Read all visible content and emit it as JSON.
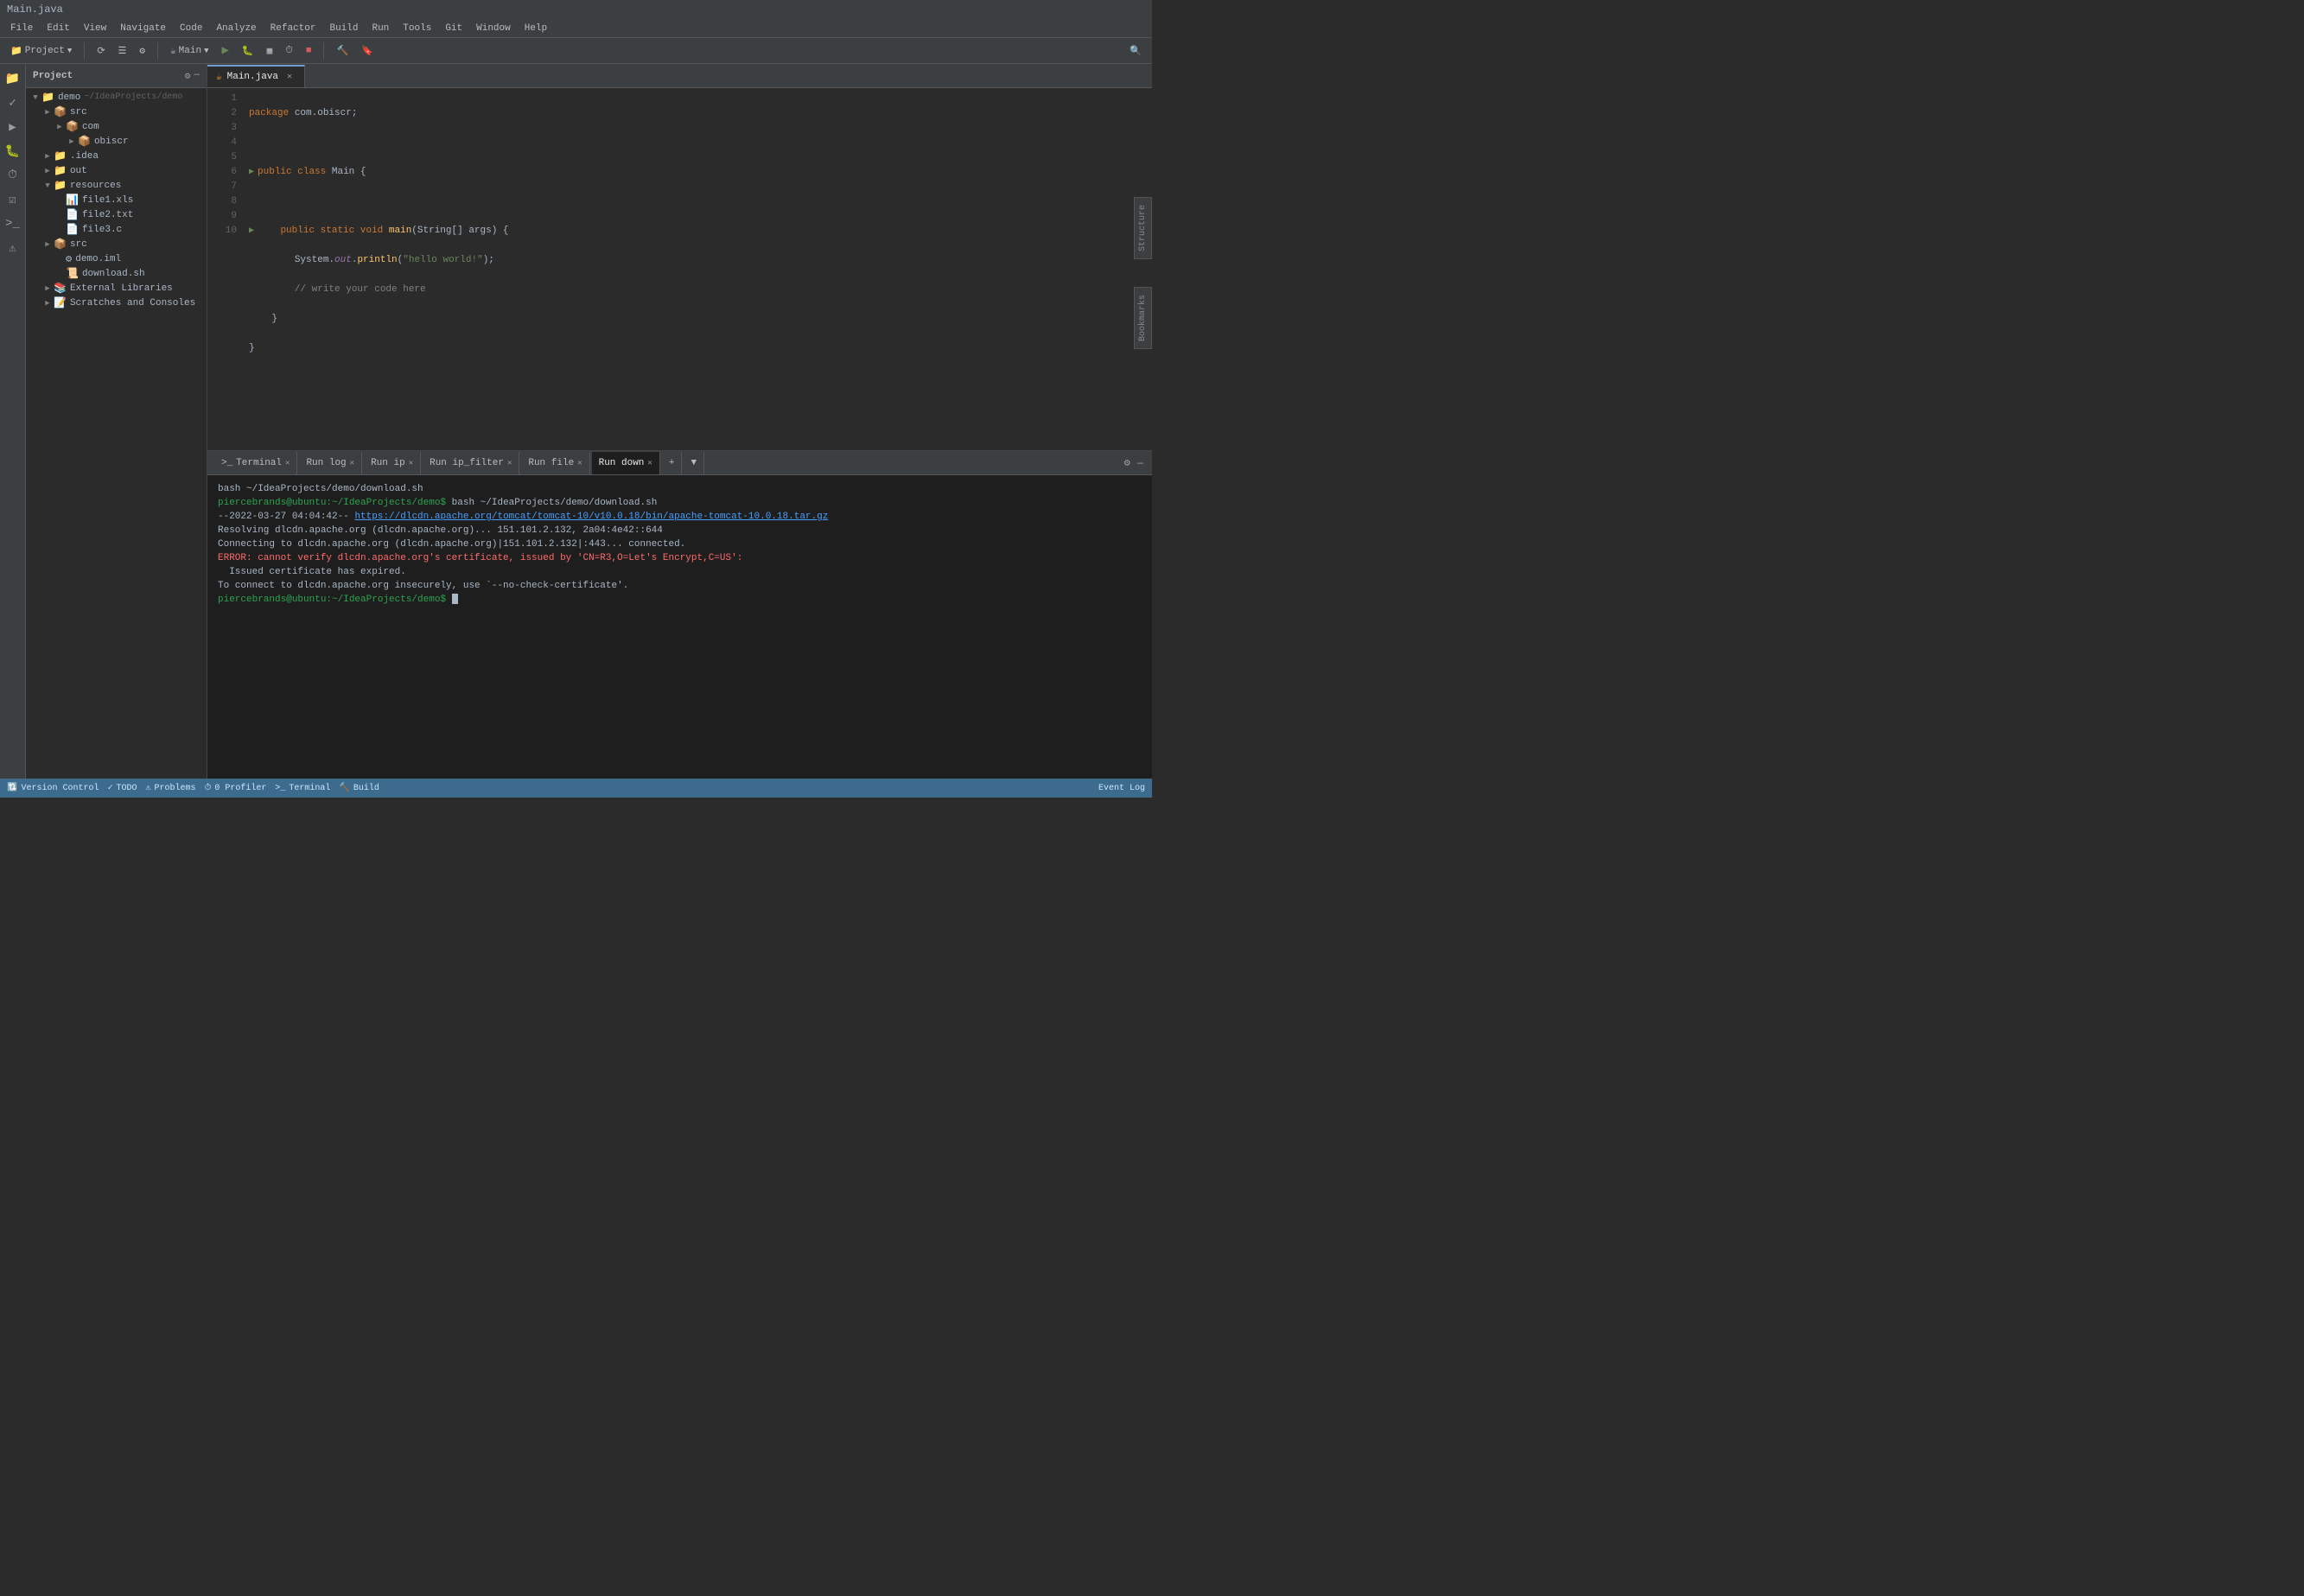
{
  "titleBar": {
    "title": "Main.java"
  },
  "menuBar": {
    "items": [
      "File",
      "Edit",
      "View",
      "Navigate",
      "Code",
      "Analyze",
      "Refactor",
      "Build",
      "Run",
      "Tools",
      "Git",
      "Window",
      "Help"
    ]
  },
  "toolbar": {
    "projectDropdown": "Project",
    "configDropdown": "Main",
    "runBtn": "▶",
    "debugBtn": "🐛",
    "coverageBtn": "▦",
    "profileBtn": "⏱",
    "buildBtn": "🔨",
    "searchBtn": "🔍"
  },
  "sidebar": {
    "title": "Project",
    "tree": [
      {
        "id": "demo",
        "label": "demo",
        "path": "~/IdeaProjects/demo",
        "depth": 0,
        "expanded": true,
        "icon": "📁",
        "type": "folder"
      },
      {
        "id": "src",
        "label": "src",
        "depth": 1,
        "expanded": false,
        "icon": "📁",
        "type": "folder"
      },
      {
        "id": "com",
        "label": "com",
        "depth": 2,
        "expanded": false,
        "icon": "📁",
        "type": "folder"
      },
      {
        "id": "obiscr",
        "label": "obiscr",
        "depth": 3,
        "expanded": false,
        "icon": "📁",
        "type": "folder"
      },
      {
        "id": "idea",
        "label": ".idea",
        "depth": 1,
        "expanded": false,
        "icon": "📁",
        "type": "folder"
      },
      {
        "id": "out",
        "label": "out",
        "depth": 1,
        "expanded": false,
        "icon": "📁",
        "type": "folder"
      },
      {
        "id": "resources",
        "label": "resources",
        "depth": 1,
        "expanded": true,
        "icon": "📁",
        "type": "folder"
      },
      {
        "id": "file1xls",
        "label": "file1.xls",
        "depth": 2,
        "icon": "📄",
        "type": "file"
      },
      {
        "id": "file2txt",
        "label": "file2.txt",
        "depth": 2,
        "icon": "📄",
        "type": "file"
      },
      {
        "id": "file3c",
        "label": "file3.c",
        "depth": 2,
        "icon": "📄",
        "type": "file"
      },
      {
        "id": "src2",
        "label": "src",
        "depth": 1,
        "expanded": false,
        "icon": "📁",
        "type": "folder"
      },
      {
        "id": "demoiml",
        "label": "demo.iml",
        "depth": 2,
        "icon": "📄",
        "type": "file"
      },
      {
        "id": "downloadsh",
        "label": "download.sh",
        "depth": 2,
        "icon": "📄",
        "type": "file"
      },
      {
        "id": "extlibs",
        "label": "External Libraries",
        "depth": 1,
        "icon": "📚",
        "type": "folder"
      },
      {
        "id": "scratches",
        "label": "Scratches and Consoles",
        "depth": 1,
        "icon": "📝",
        "type": "folder"
      }
    ]
  },
  "editor": {
    "tabs": [
      {
        "id": "main-java",
        "label": "Main.java",
        "active": true,
        "icon": "☕"
      }
    ],
    "code": [
      {
        "line": 1,
        "content": "package com.obiscr;",
        "hasArrow": false
      },
      {
        "line": 2,
        "content": "",
        "hasArrow": false
      },
      {
        "line": 3,
        "content": "public class Main {",
        "hasArrow": true
      },
      {
        "line": 4,
        "content": "",
        "hasArrow": false
      },
      {
        "line": 5,
        "content": "    public static void main(String[] args) {",
        "hasArrow": true
      },
      {
        "line": 6,
        "content": "        System.out.println(\"hello world!\");",
        "hasArrow": false
      },
      {
        "line": 7,
        "content": "        // write your code here",
        "hasArrow": false
      },
      {
        "line": 8,
        "content": "    }",
        "hasArrow": false
      },
      {
        "line": 9,
        "content": "}",
        "hasArrow": false
      },
      {
        "line": 10,
        "content": "",
        "hasArrow": false
      }
    ]
  },
  "terminal": {
    "tabs": [
      {
        "id": "terminal",
        "label": "Terminal",
        "active": false
      },
      {
        "id": "run-log",
        "label": "Run log",
        "active": false
      },
      {
        "id": "run-ip",
        "label": "Run ip",
        "active": false
      },
      {
        "id": "run-ip-filter",
        "label": "Run ip_filter",
        "active": false
      },
      {
        "id": "run-file",
        "label": "Run file",
        "active": false
      },
      {
        "id": "run-down",
        "label": "Run down",
        "active": true
      }
    ],
    "output": [
      {
        "type": "cmd",
        "text": "bash ~/IdeaProjects/demo/download.sh"
      },
      {
        "type": "prompt",
        "text": "piercebrands@ubuntu:~/IdeaProjects/demo$",
        "cmd": " bash ~/IdeaProjects/demo/download.sh"
      },
      {
        "type": "info",
        "text": "--2022-03-27 04:04:42--  ",
        "link": "https://dlcdn.apache.org/tomcat/tomcat-10/v10.0.18/bin/apache-tomcat-10.0.18.tar.gz"
      },
      {
        "type": "plain",
        "text": "Resolving dlcdn.apache.org (dlcdn.apache.org)... 151.101.2.132, 2a04:4e42::644"
      },
      {
        "type": "plain",
        "text": "Connecting to dlcdn.apache.org (dlcdn.apache.org)|151.101.2.132|:443... connected."
      },
      {
        "type": "error",
        "text": "ERROR: cannot verify dlcdn.apache.org's certificate, issued by 'CN=R3,O=Let's Encrypt,C=US':"
      },
      {
        "type": "plain",
        "text": "  Issued certificate has expired."
      },
      {
        "type": "plain",
        "text": "To connect to dlcdn.apache.org insecurely, use `--no-check-certificate'."
      },
      {
        "type": "prompt2",
        "text": "piercebrands@ubuntu:~/IdeaProjects/demo$"
      }
    ]
  },
  "statusBar": {
    "left": [
      {
        "id": "vcs",
        "label": "Version Control"
      },
      {
        "id": "todo",
        "label": "TODO"
      },
      {
        "id": "problems",
        "label": "Problems"
      },
      {
        "id": "profiler",
        "label": "0 Profiler"
      },
      {
        "id": "terminal-status",
        "label": "Terminal"
      },
      {
        "id": "build",
        "label": "Build"
      }
    ],
    "right": [
      {
        "id": "event-log",
        "label": "Event Log"
      }
    ]
  }
}
